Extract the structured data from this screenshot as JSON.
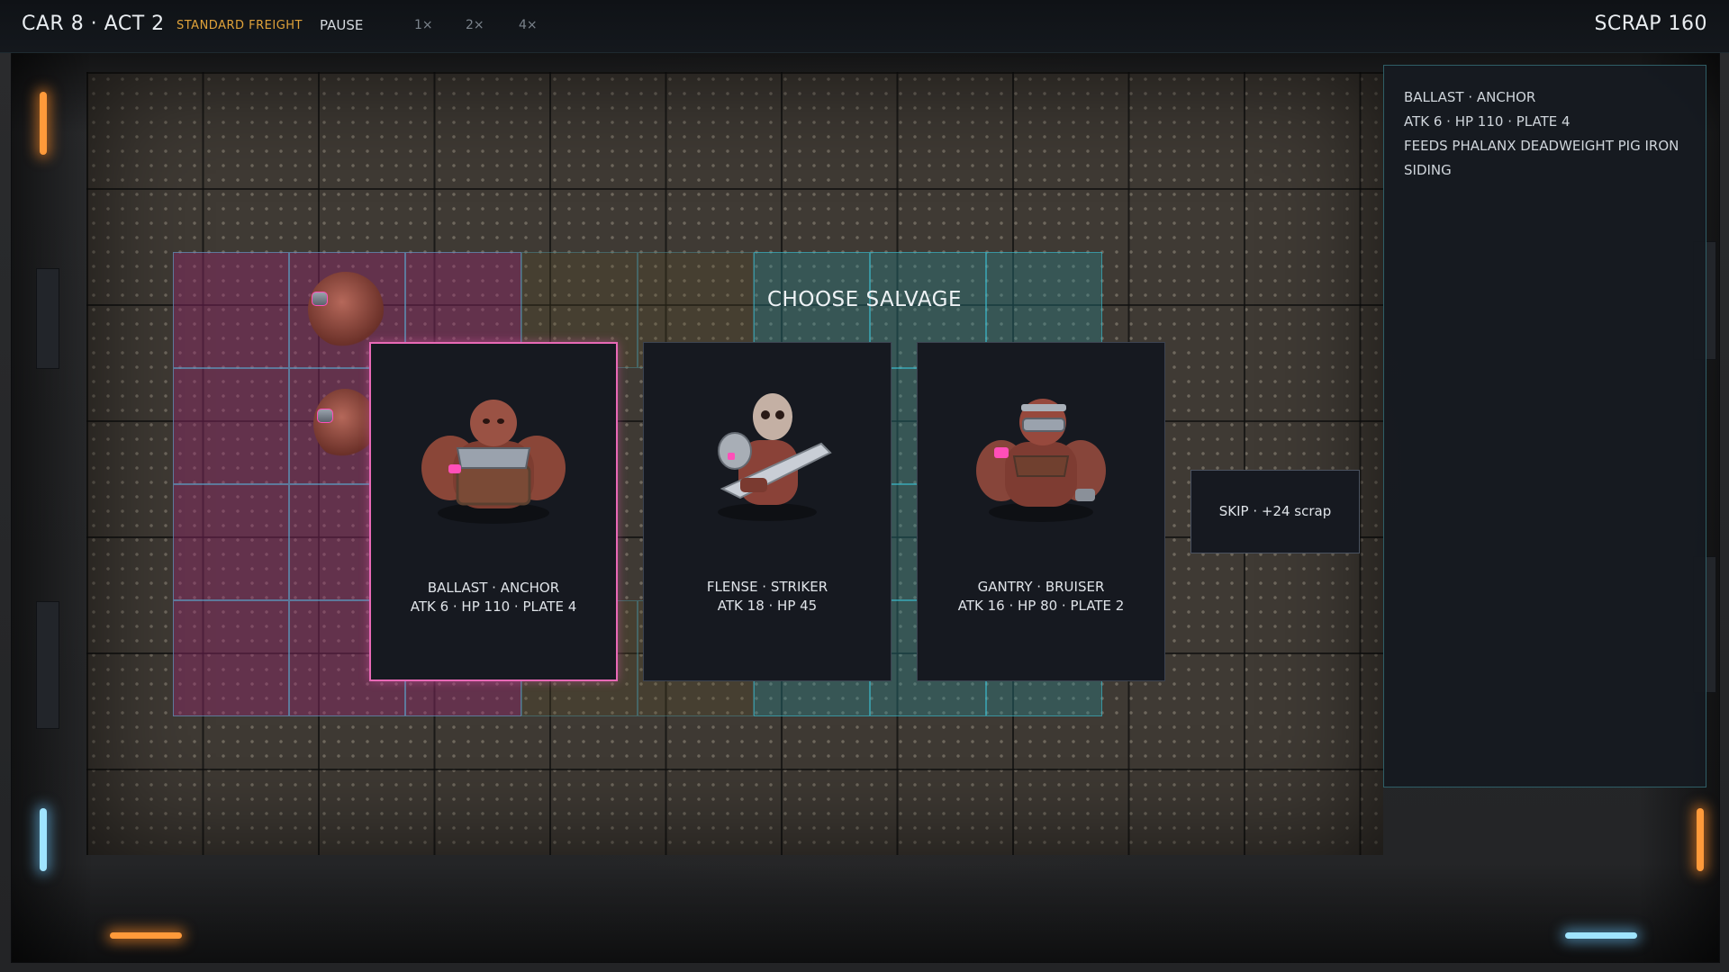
{
  "topbar": {
    "act": "CAR 8 · ACT 2",
    "mode": "STANDARD FREIGHT",
    "pause": "PAUSE",
    "speeds": [
      "1×",
      "2×",
      "4×"
    ],
    "scrap": "SCRAP 160"
  },
  "salvage": {
    "title": "CHOOSE SALVAGE",
    "cards": [
      {
        "name": "BALLAST · ANCHOR",
        "stats": "ATK 6 · HP 110 · PLATE 4",
        "selected": true
      },
      {
        "name": "FLENSE · STRIKER",
        "stats": "ATK 18 · HP 45",
        "selected": false
      },
      {
        "name": "GANTRY · BRUISER",
        "stats": "ATK 16 · HP 80 · PLATE 2",
        "selected": false
      }
    ],
    "skip": "SKIP · +24 scrap"
  },
  "info": {
    "line1": "BALLAST · ANCHOR",
    "line2": "ATK 6 · HP 110 · PLATE 4",
    "line3": "FEEDS  PHALANX  DEADWEIGHT  PIG IRON",
    "line4": "SIDING"
  },
  "colors": {
    "accent_pink": "#e869b6",
    "accent_orange": "#e0a23a",
    "tile_teal": "#2c8c96",
    "tile_pink": "#96286e"
  }
}
